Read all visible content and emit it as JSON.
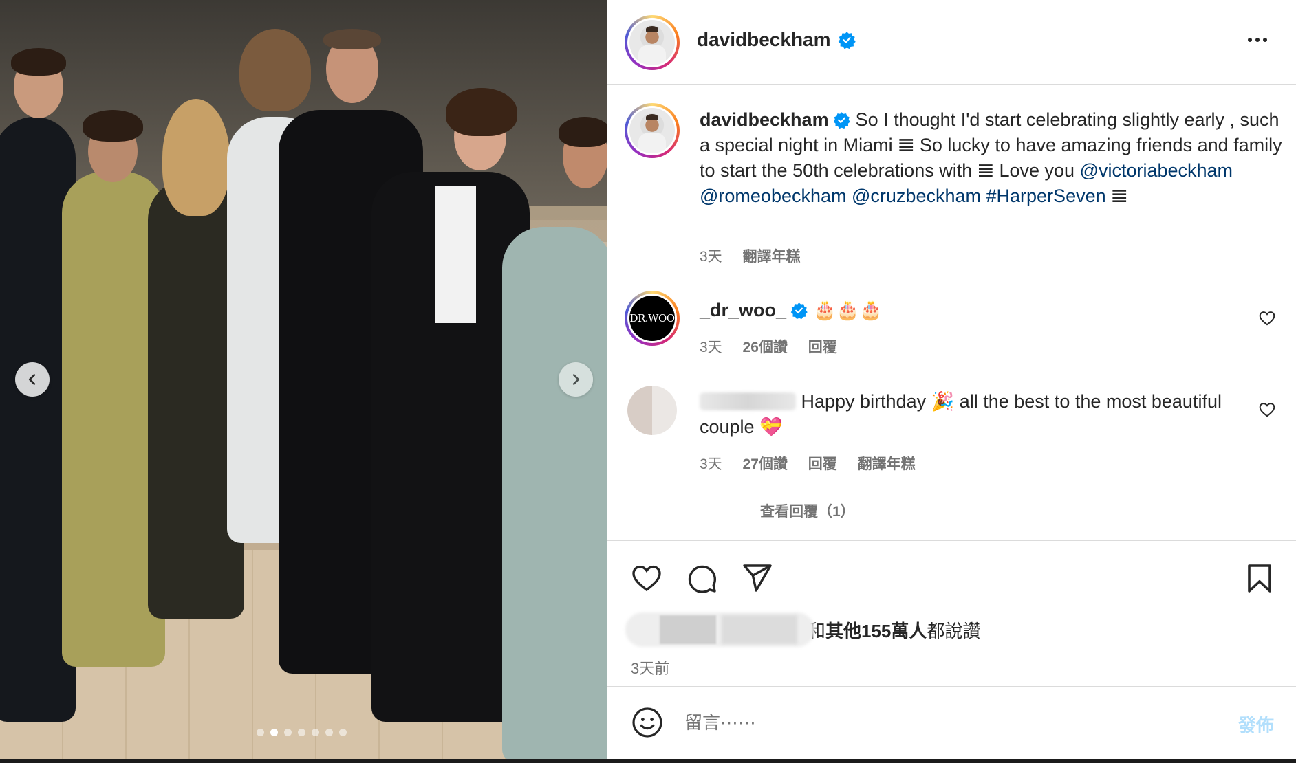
{
  "post": {
    "username": "davidbeckham",
    "verified": true,
    "carousel": {
      "total_slides": 7,
      "active_slide": 2
    }
  },
  "caption": {
    "username": "davidbeckham",
    "text_1": "So I thought I'd start celebrating slightly early , such a special night in Miami ",
    "emoji_1": "𝌆",
    "text_2": " So lucky to have amazing friends and family to start the 50th celebrations with ",
    "emoji_2": "𝌆",
    "text_3": " Love you ",
    "mention_1": "@victoriabeckham",
    "mention_2": "@romeobeckham",
    "mention_3": "@cruzbeckham",
    "hashtag": "#HarperSeven",
    "emoji_3": "𝌆",
    "time": "3天",
    "translate": "翻譯年糕"
  },
  "comments": [
    {
      "username": "_dr_woo_",
      "avatar_text": "DR.WOO",
      "verified": true,
      "text": "🎂🎂🎂",
      "time": "3天",
      "likes": "26個讚",
      "reply": "回覆"
    },
    {
      "username": "",
      "verified": false,
      "text": " Happy birthday 🎉 all the best to the most beautiful couple 💝",
      "time": "3天",
      "likes": "27個讚",
      "reply": "回覆",
      "translate": "翻譯年糕",
      "view_replies": "查看回覆（1）"
    }
  ],
  "likes": {
    "summary_prefix": "和",
    "summary_bold": "其他155萬人",
    "summary_suffix": "都說讚",
    "time_ago": "3天前"
  },
  "comment_box": {
    "placeholder": "留言⋯⋯",
    "post_label": "發佈"
  },
  "icons": {
    "like": "heart-icon",
    "comment": "comment-bubble-icon",
    "share": "paper-plane-icon",
    "save": "bookmark-icon",
    "emoji": "smiley-icon",
    "more": "more-horizontal-icon",
    "verified": "verified-badge-icon",
    "prev": "chevron-left-icon",
    "next": "chevron-right-icon"
  },
  "colors": {
    "link": "#00376b",
    "verified": "#0095f6",
    "muted": "#737373",
    "post_button_disabled": "#b2dffc"
  }
}
